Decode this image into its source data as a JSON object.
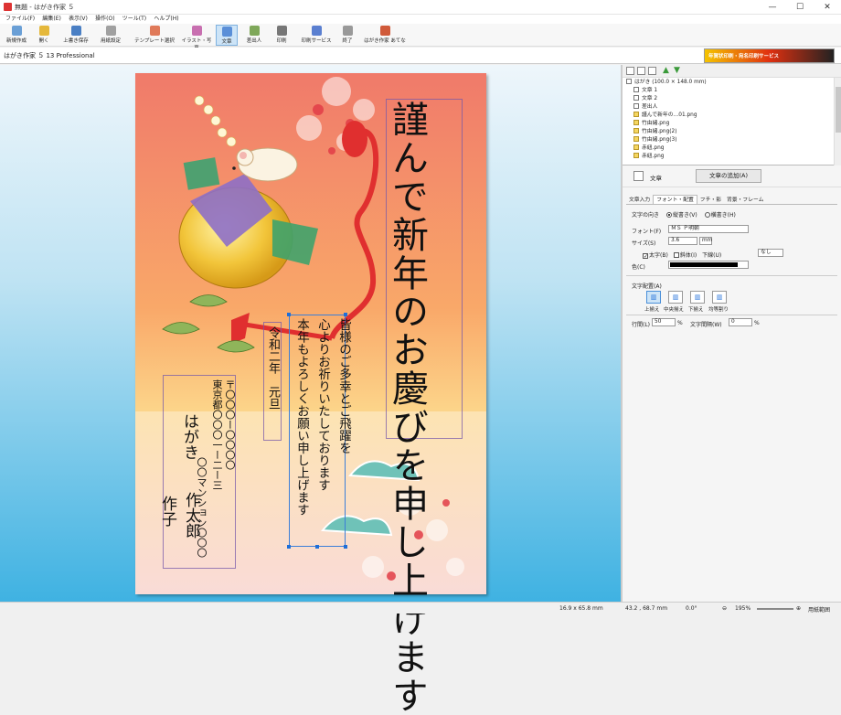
{
  "window": {
    "title": "無題 - はがき作家 ５",
    "min": "—",
    "max": "☐",
    "close": "✕"
  },
  "menu": [
    "ファイル(F)",
    "編集(E)",
    "表示(V)",
    "操作(O)",
    "ツール(T)",
    "ヘルプ(H)"
  ],
  "toolbar": [
    {
      "label": "新規作成",
      "icon": "new-doc-icon",
      "color": "#6a9fd6"
    },
    {
      "label": "開く",
      "icon": "folder-open-icon",
      "color": "#e5b83b"
    },
    {
      "label": "上書き保存",
      "icon": "save-icon",
      "color": "#4a7fc4"
    },
    {
      "label": "用紙設定",
      "icon": "paper-setup-icon",
      "color": "#a0a0a0"
    },
    {
      "label": "テンプレート選択",
      "icon": "template-icon",
      "color": "#e07a5a"
    },
    {
      "label": "イラスト・写真",
      "icon": "illustration-icon",
      "color": "#c86fb0"
    },
    {
      "label": "文章",
      "icon": "text-icon",
      "color": "#5a8fd8"
    },
    {
      "label": "差出人",
      "icon": "sender-icon",
      "color": "#7fa85a"
    },
    {
      "label": "印刷",
      "icon": "print-icon",
      "color": "#777777"
    },
    {
      "label": "印刷サービス",
      "icon": "print-service-icon",
      "color": "#5a7fd0"
    },
    {
      "label": "終了",
      "icon": "exit-icon",
      "color": "#999999"
    },
    {
      "label": "はがき作家 あてな",
      "icon": "address-app-icon",
      "color": "#d05a3a"
    }
  ],
  "product": "はがき作家 ５ 13 Professional",
  "banner": "年賀状印刷・宛名印刷サービス",
  "card": {
    "greeting": "謹んで新年のお慶びを申し上げます",
    "body": [
      "皆様のご多幸とご飛躍を",
      "心よりお祈りいたしております",
      "本年もよろしくお願い申し上げます"
    ],
    "date": "令和二年　元旦",
    "address1": "〒〇〇〇ー〇〇〇〇",
    "address2": "東京都〇〇〇一ー二ー三",
    "address3": "〇〇マンション〇〇〇",
    "name1": "はがき",
    "name2": "作太郎",
    "name3": "作子"
  },
  "tree": {
    "root": "はがき (100.0 × 148.0 mm)",
    "items": [
      "文章 1",
      "文章 2",
      "差出人",
      "謹んで新年の…01.png",
      "竹由緒.png",
      "竹由緒.png(2)",
      "竹由緒.png(3)",
      "赤紐.png",
      "赤紐.png"
    ]
  },
  "panel": {
    "label": "文章",
    "add_button": "文章の追加(A)",
    "tabs": [
      "文章入力",
      "フォント・配置",
      "フチ・影",
      "背景・フレーム"
    ],
    "direction_label": "文字の向き",
    "vertical": "縦書き(V)",
    "horizontal": "横書き(H)",
    "font_label": "フォント(F)",
    "font_value": "ＭＳ Ｐ明朝",
    "size_label": "サイズ(S)",
    "size_value": "3.6",
    "size_unit": "mm",
    "bold": "太字(B)",
    "italic": "斜体(I)",
    "underline_label": "下線(U)",
    "underline_value": "なし",
    "color_label": "色(C)",
    "color_value": "#000000",
    "align_label": "文字配置(A)",
    "align": [
      "上揃え",
      "中央揃え",
      "下揃え",
      "均等割り"
    ],
    "line_spacing_label": "行間(L)",
    "line_spacing": "50",
    "char_spacing_label": "文字間隔(W)",
    "char_spacing": "0",
    "percent": "%"
  },
  "status": {
    "size": "16.9 x 65.8 mm",
    "pos": "43.2 , 68.7 mm",
    "angle": "0.0°",
    "zoom": "195%",
    "fit": "用紙範囲"
  }
}
